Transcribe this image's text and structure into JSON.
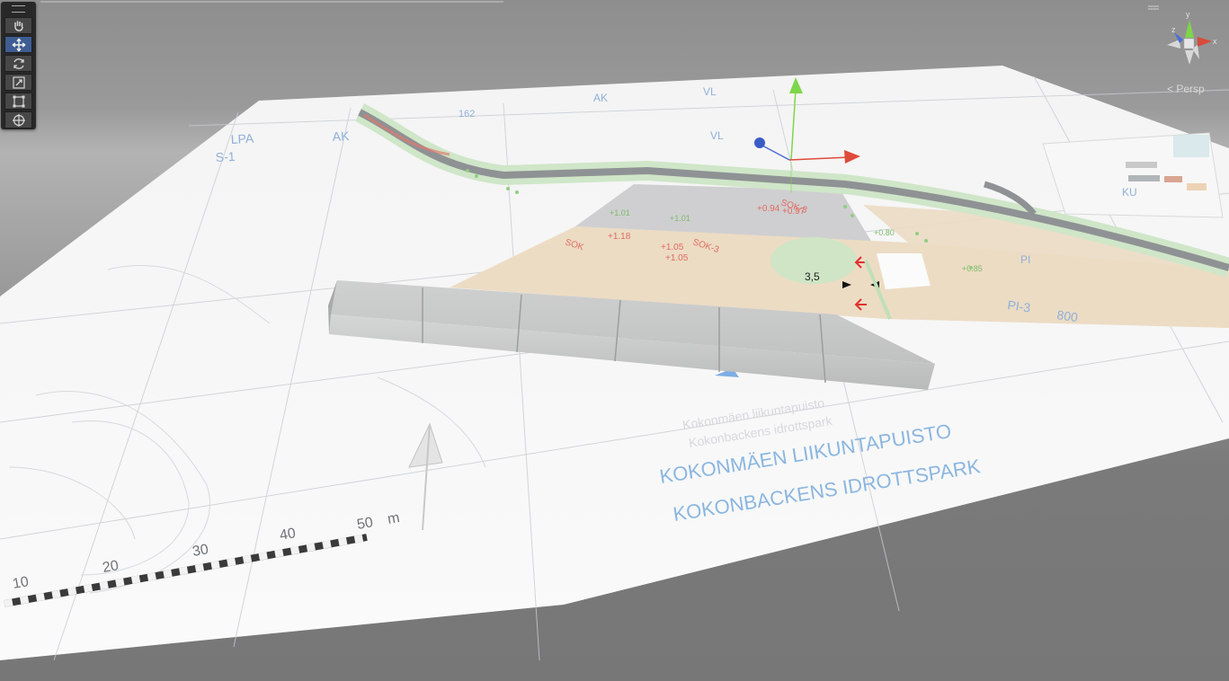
{
  "toolbar": {
    "tools": [
      {
        "name": "hand-tool",
        "active": false
      },
      {
        "name": "move-tool",
        "active": true
      },
      {
        "name": "rotate-tool",
        "active": false
      },
      {
        "name": "scale-tool",
        "active": false
      },
      {
        "name": "rect-tool",
        "active": false
      },
      {
        "name": "transform-tool",
        "active": false
      }
    ]
  },
  "gizmo": {
    "axis_x": "x",
    "axis_y": "y",
    "axis_z": "z",
    "projection_label": "Persp",
    "colors": {
      "x": "#d94a3a",
      "y": "#7ed64a",
      "z": "#4a6ed8"
    }
  },
  "map": {
    "zone_labels": [
      "LPA",
      "AK",
      "S-1",
      "AK",
      "VL",
      "VL",
      "KU",
      "PI",
      "PI-3",
      "800",
      "162"
    ],
    "values_red": [
      "SOK",
      "+1.18",
      "+1.05",
      "+1.05",
      "SOK-3",
      "+0.94",
      "+0.97",
      "SOK-3"
    ],
    "values_green": [
      "+1.01",
      "+1.01",
      "+0.85",
      "+0.80"
    ],
    "dimension_text": "3,5",
    "park_name_fi": "KOKONMÄEN LIIKUNTAPUISTO",
    "park_name_sv": "KOKONBACKENS IDROTTSPARK",
    "park_name_fi_small": "Kokonmäen liikuntapuisto",
    "park_name_sv_small": "Kokonbackens idrottspark",
    "scale_labels": [
      "10",
      "20",
      "30",
      "40",
      "50",
      "m"
    ]
  }
}
